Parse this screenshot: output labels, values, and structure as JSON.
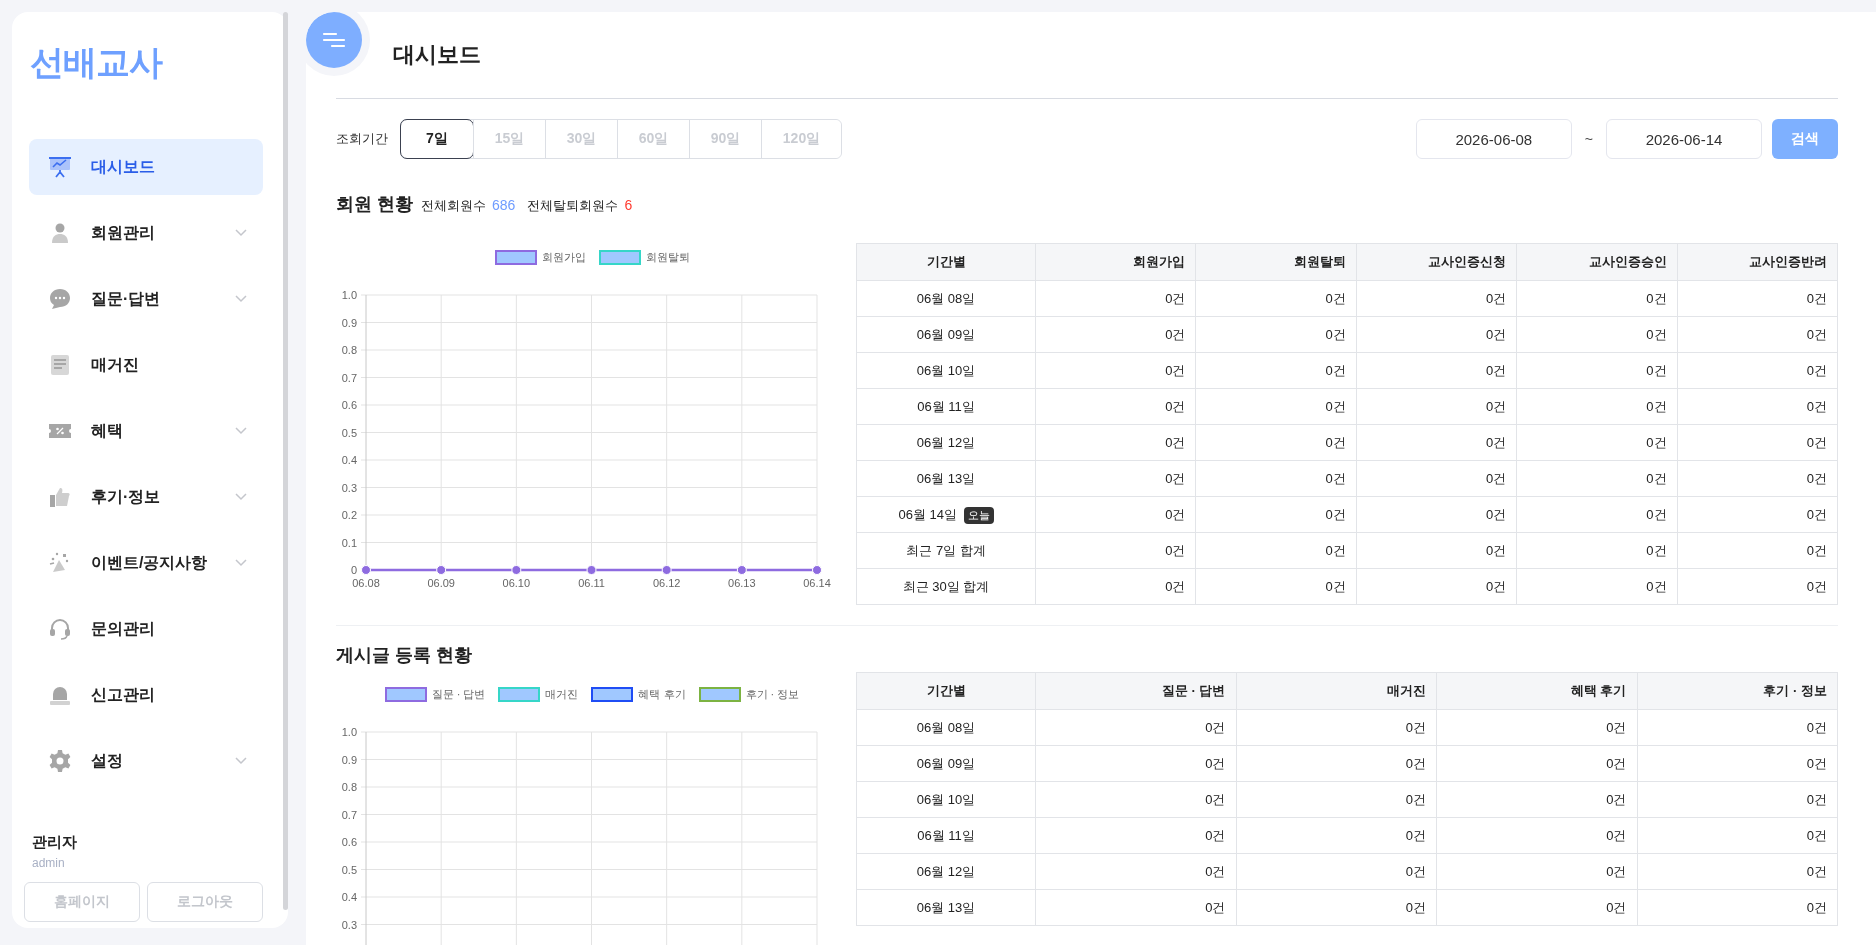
{
  "sidebar": {
    "logo": "선배교사",
    "items": [
      {
        "label": "대시보드",
        "selected": true,
        "has_submenu": false
      },
      {
        "label": "회원관리",
        "selected": false,
        "has_submenu": true
      },
      {
        "label": "질문·답변",
        "selected": false,
        "has_submenu": true
      },
      {
        "label": "매거진",
        "selected": false,
        "has_submenu": false
      },
      {
        "label": "혜택",
        "selected": false,
        "has_submenu": true
      },
      {
        "label": "후기·정보",
        "selected": false,
        "has_submenu": true
      },
      {
        "label": "이벤트/공지사항",
        "selected": false,
        "has_submenu": true
      },
      {
        "label": "문의관리",
        "selected": false,
        "has_submenu": false
      },
      {
        "label": "신고관리",
        "selected": false,
        "has_submenu": false
      },
      {
        "label": "설정",
        "selected": false,
        "has_submenu": true
      }
    ],
    "user": {
      "name": "관리자",
      "id": "admin"
    },
    "buttons": [
      "홈페이지",
      "로그아웃"
    ]
  },
  "page_title": "대시보드",
  "filter": {
    "label": "조회기간",
    "periods": [
      {
        "label": "7일",
        "selected": true
      },
      {
        "label": "15일",
        "selected": false
      },
      {
        "label": "30일",
        "selected": false
      },
      {
        "label": "60일",
        "selected": false
      },
      {
        "label": "90일",
        "selected": false
      },
      {
        "label": "120일",
        "selected": false
      }
    ],
    "start_date": "2026-06-08",
    "separator": "~",
    "end_date": "2026-06-14",
    "search_button": "검색"
  },
  "sections": [
    {
      "title": "회원 현황",
      "stats": [
        {
          "label": "전체회원수",
          "value": "686",
          "color": "#6f9cff"
        },
        {
          "label": "전체탈퇴회원수",
          "value": "6",
          "color": "#ff3b30"
        }
      ],
      "chart_data": {
        "type": "line",
        "grid": true,
        "legend": true,
        "categories": [
          "06.08",
          "06.09",
          "06.10",
          "06.11",
          "06.12",
          "06.13",
          "06.14"
        ],
        "ylim": [
          0,
          1
        ],
        "yticks": [
          {
            "value": 0,
            "label": "0"
          },
          {
            "value": 0.1,
            "label": "0.1"
          },
          {
            "value": 0.2,
            "label": "0.2"
          },
          {
            "value": 0.3,
            "label": "0.3"
          },
          {
            "value": 0.4,
            "label": "0.4"
          },
          {
            "value": 0.5,
            "label": "0.5"
          },
          {
            "value": 0.6,
            "label": "0.6"
          },
          {
            "value": 0.7,
            "label": "0.7"
          },
          {
            "value": 0.8,
            "label": "0.8"
          },
          {
            "value": 0.9,
            "label": "0.9"
          },
          {
            "value": 1,
            "label": "1.0"
          }
        ],
        "series": [
          {
            "name": "회원가입",
            "color": "#8e6be0",
            "marker": true,
            "values": [
              0,
              0,
              0,
              0,
              0,
              0,
              0
            ]
          },
          {
            "name": "회원탈퇴",
            "color": "#36d6c8",
            "values": [
              null,
              null,
              null,
              null,
              null,
              null,
              null
            ]
          }
        ]
      },
      "table": {
        "columns": [
          "기간별",
          "회원가입",
          "회원탈퇴",
          "교사인증신청",
          "교사인증승인",
          "교사인증반려"
        ],
        "rows": [
          {
            "cells": [
              "06월 08일",
              "0건",
              "0건",
              "0건",
              "0건",
              "0건"
            ]
          },
          {
            "cells": [
              "06월 09일",
              "0건",
              "0건",
              "0건",
              "0건",
              "0건"
            ]
          },
          {
            "cells": [
              "06월 10일",
              "0건",
              "0건",
              "0건",
              "0건",
              "0건"
            ]
          },
          {
            "cells": [
              "06월 11일",
              "0건",
              "0건",
              "0건",
              "0건",
              "0건"
            ]
          },
          {
            "cells": [
              "06월 12일",
              "0건",
              "0건",
              "0건",
              "0건",
              "0건"
            ]
          },
          {
            "cells": [
              "06월 13일",
              "0건",
              "0건",
              "0건",
              "0건",
              "0건"
            ]
          },
          {
            "badge": "오늘",
            "cells": [
              "06월 14일",
              "0건",
              "0건",
              "0건",
              "0건",
              "0건"
            ]
          },
          {
            "cells": [
              "최근 7일 합계",
              "0건",
              "0건",
              "0건",
              "0건",
              "0건"
            ]
          },
          {
            "cells": [
              "최근 30일 합계",
              "0건",
              "0건",
              "0건",
              "0건",
              "0건"
            ]
          }
        ]
      }
    },
    {
      "title": "게시글 등록 현황",
      "chart_data": {
        "type": "line",
        "grid": true,
        "legend": true,
        "ylim": [
          0,
          1
        ],
        "yticks": [
          {
            "value": 0.3,
            "label": "0.3"
          },
          {
            "value": 0.4,
            "label": "0.4"
          },
          {
            "value": 0.5,
            "label": "0.5"
          },
          {
            "value": 0.6,
            "label": "0.6"
          },
          {
            "value": 0.7,
            "label": "0.7"
          },
          {
            "value": 0.8,
            "label": "0.8"
          },
          {
            "value": 0.9,
            "label": "0.9"
          },
          {
            "value": 1,
            "label": "1.0"
          }
        ],
        "series": [
          {
            "name": "질문 · 답변",
            "color": "#8e6be0"
          },
          {
            "name": "매거진",
            "color": "#36d6c8"
          },
          {
            "name": "혜택 후기",
            "color": "#1f4df5"
          },
          {
            "name": "후기 · 정보",
            "color": "#7cb342"
          }
        ]
      },
      "table": {
        "columns": [
          "기간별",
          "질문 · 답변",
          "매거진",
          "혜택 후기",
          "후기 · 정보"
        ],
        "rows": [
          {
            "cells": [
              "06월 08일",
              "0건",
              "0건",
              "0건",
              "0건"
            ]
          },
          {
            "cells": [
              "06월 09일",
              "0건",
              "0건",
              "0건",
              "0건"
            ]
          },
          {
            "cells": [
              "06월 10일",
              "0건",
              "0건",
              "0건",
              "0건"
            ]
          },
          {
            "cells": [
              "06월 11일",
              "0건",
              "0건",
              "0건",
              "0건"
            ]
          },
          {
            "cells": [
              "06월 12일",
              "0건",
              "0건",
              "0건",
              "0건"
            ]
          },
          {
            "cells": [
              "06월 13일",
              "0건",
              "0건",
              "0건",
              "0건"
            ]
          }
        ]
      }
    }
  ]
}
